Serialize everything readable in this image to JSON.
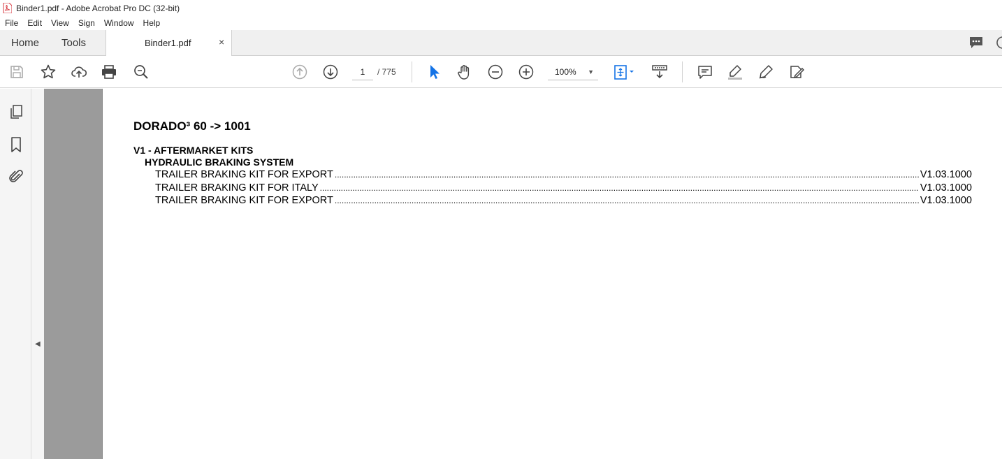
{
  "window": {
    "title": "Binder1.pdf - Adobe Acrobat Pro DC (32-bit)"
  },
  "menu": [
    "File",
    "Edit",
    "View",
    "Sign",
    "Window",
    "Help"
  ],
  "tabs": {
    "home": "Home",
    "tools": "Tools",
    "document": "Binder1.pdf",
    "close": "×"
  },
  "toolbar": {
    "page_current": "1",
    "page_total": "/ 775",
    "zoom": "100%"
  },
  "document": {
    "title": "DORADO³ 60 -> 1001",
    "section": "V1 - AFTERMARKET KITS",
    "subsection": "HYDRAULIC BRAKING SYSTEM",
    "entries": [
      {
        "title": "TRAILER BRAKING KIT FOR EXPORT",
        "ref": "V1.03.1000"
      },
      {
        "title": "TRAILER BRAKING KIT FOR ITALY",
        "ref": "V1.03.1000"
      },
      {
        "title": "TRAILER BRAKING KIT FOR EXPORT",
        "ref": "V1.03.1000"
      }
    ]
  },
  "colors": {
    "accent_blue": "#1473e6",
    "pdf_red": "#d7373f",
    "gray_pane": "#9b9b9b"
  }
}
